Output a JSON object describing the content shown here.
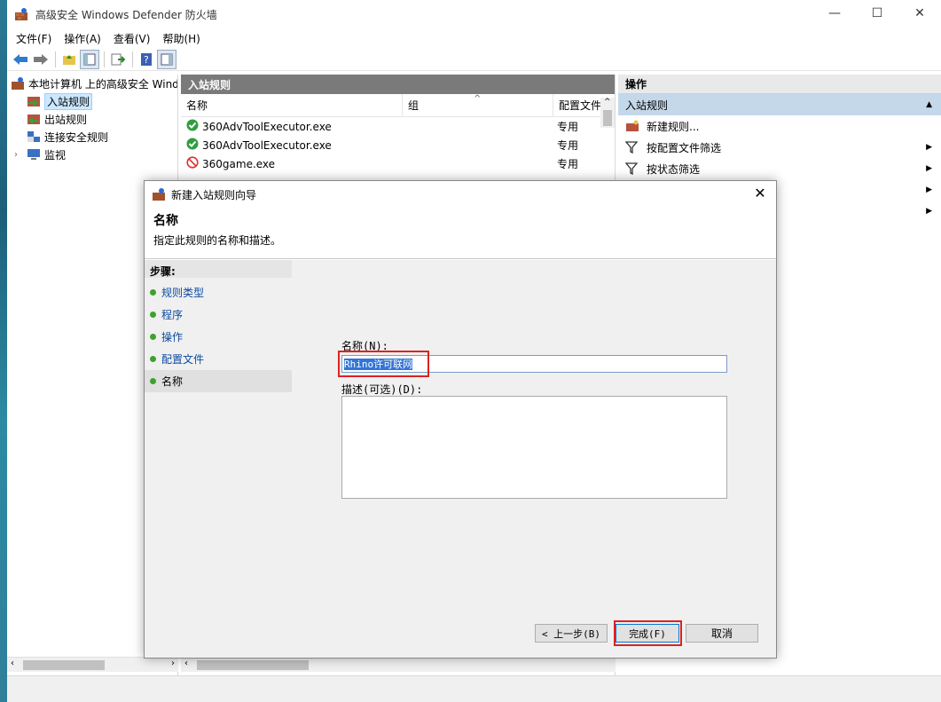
{
  "window": {
    "title": "高级安全 Windows Defender 防火墙",
    "minimize": "—",
    "maximize": "☐",
    "close": "✕"
  },
  "menu": [
    "文件(F)",
    "操作(A)",
    "查看(V)",
    "帮助(H)"
  ],
  "tree": {
    "root": "本地计算机 上的高级安全 Windows",
    "items": [
      "入站规则",
      "出站规则",
      "连接安全规则",
      "监视"
    ]
  },
  "center": {
    "header": "入站规则",
    "columns": [
      "名称",
      "组",
      "配置文件"
    ],
    "rows": [
      {
        "name": "360AdvToolExecutor.exe",
        "profile": "专用",
        "status": "allow"
      },
      {
        "name": "360AdvToolExecutor.exe",
        "profile": "专用",
        "status": "allow"
      },
      {
        "name": "360game.exe",
        "profile": "专用",
        "status": "block"
      }
    ]
  },
  "actions": {
    "header": "操作",
    "section": "入站规则",
    "items": [
      "新建规则...",
      "按配置文件筛选",
      "按状态筛选"
    ]
  },
  "dialog": {
    "title": "新建入站规则向导",
    "heading": "名称",
    "subheading": "指定此规则的名称和描述。",
    "steps_title": "步骤:",
    "steps": [
      "规则类型",
      "程序",
      "操作",
      "配置文件",
      "名称"
    ],
    "name_label": "名称(N):",
    "name_value": "Rhino许可联网",
    "desc_label": "描述(可选)(D):",
    "back_button": "< 上一步(B)",
    "finish_button": "完成(F)",
    "cancel_button": "取消"
  },
  "colors": {
    "accent_red": "#d22222",
    "header_gray": "#7a7a7a",
    "selection_blue": "#3375d6"
  }
}
